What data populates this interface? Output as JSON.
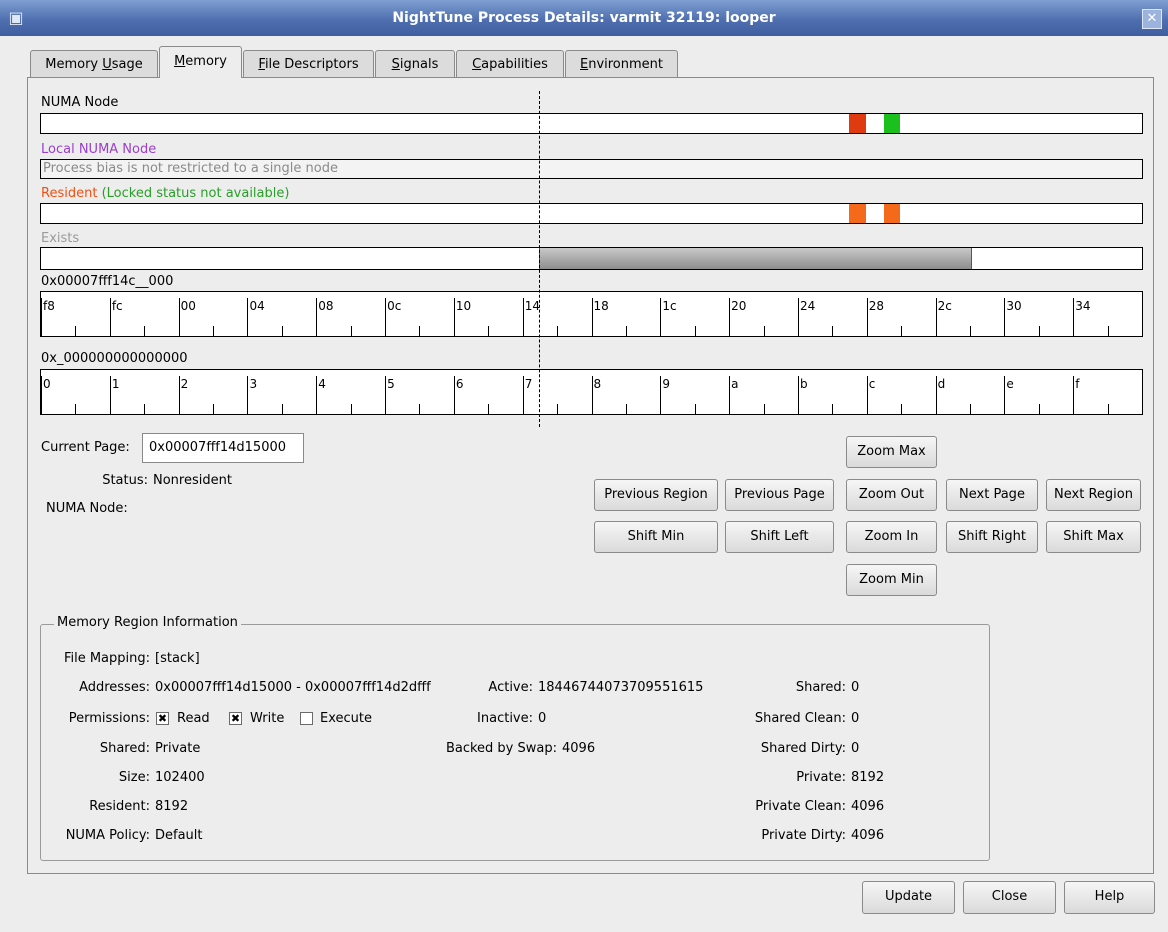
{
  "window": {
    "title": "NightTune Process Details: varmit 32119: looper"
  },
  "tabs": [
    {
      "pre": "Memory ",
      "key": "U",
      "post": "sage"
    },
    {
      "pre": "",
      "key": "M",
      "post": "emory"
    },
    {
      "pre": "",
      "key": "F",
      "post": "ile Descriptors"
    },
    {
      "pre": "",
      "key": "S",
      "post": "ignals"
    },
    {
      "pre": "",
      "key": "C",
      "post": "apabilities"
    },
    {
      "pre": "",
      "key": "E",
      "post": "nvironment"
    }
  ],
  "tracks": {
    "numa_label": "NUMA Node",
    "local_numa_label": "Local NUMA Node",
    "local_numa_text": "Process bias is not restricted to a single node",
    "resident_label": "Resident",
    "locked_label": "(Locked status not available)",
    "exists_label": "Exists"
  },
  "colors": {
    "numa_red": "#e03a10",
    "numa_green": "#1cc01c",
    "resident_orange": "#f46a1a",
    "local_purple": "#9a3fc9",
    "locked_green": "#28a028",
    "exists_grey": "#9a9a9a"
  },
  "ruler1": {
    "label": "0x00007fff14c__000",
    "ticks": [
      "f8",
      "fc",
      "00",
      "04",
      "08",
      "0c",
      "10",
      "14",
      "18",
      "1c",
      "20",
      "24",
      "28",
      "2c",
      "30",
      "34"
    ]
  },
  "ruler2": {
    "label": "0x_000000000000000",
    "ticks": [
      "0",
      "1",
      "2",
      "3",
      "4",
      "5",
      "6",
      "7",
      "8",
      "9",
      "a",
      "b",
      "c",
      "d",
      "e",
      "f"
    ]
  },
  "page": {
    "current_page_label": "Current Page:",
    "current_page_value": "0x00007fff14d15000",
    "status_label": "Status:",
    "status_value": "Nonresident",
    "numa_node_label": "NUMA Node:"
  },
  "nav": {
    "zoom_max": "Zoom Max",
    "prev_region": "Previous Region",
    "prev_page": "Previous Page",
    "zoom_out": "Zoom Out",
    "next_page": "Next Page",
    "next_region": "Next Region",
    "shift_min": "Shift Min",
    "shift_left": "Shift Left",
    "zoom_in": "Zoom In",
    "shift_right": "Shift Right",
    "shift_max": "Shift Max",
    "zoom_min": "Zoom Min"
  },
  "region": {
    "title": "Memory Region Information",
    "file_mapping_label": "File Mapping:",
    "file_mapping": "[stack]",
    "addresses_label": "Addresses:",
    "addresses": "0x00007fff14d15000 - 0x00007fff14d2dfff",
    "permissions_label": "Permissions:",
    "read": "Read",
    "write": "Write",
    "execute": "Execute",
    "read_checked": true,
    "write_checked": true,
    "execute_checked": false,
    "shared_label": "Shared:",
    "shared": "Private",
    "size_label": "Size:",
    "size": "102400",
    "resident_label": "Resident:",
    "resident": "8192",
    "numa_policy_label": "NUMA Policy:",
    "numa_policy": "Default",
    "active_label": "Active:",
    "active": "18446744073709551615",
    "inactive_label": "Inactive:",
    "inactive": "0",
    "backed_label": "Backed by Swap:",
    "backed": "4096",
    "shared2_label": "Shared:",
    "shared2": "0",
    "shared_clean_label": "Shared Clean:",
    "shared_clean": "0",
    "shared_dirty_label": "Shared Dirty:",
    "shared_dirty": "0",
    "private_label": "Private:",
    "private": "8192",
    "private_clean_label": "Private Clean:",
    "private_clean": "4096",
    "private_dirty_label": "Private Dirty:",
    "private_dirty": "4096"
  },
  "footer": {
    "update": "Update",
    "close": "Close",
    "help": "Help"
  }
}
